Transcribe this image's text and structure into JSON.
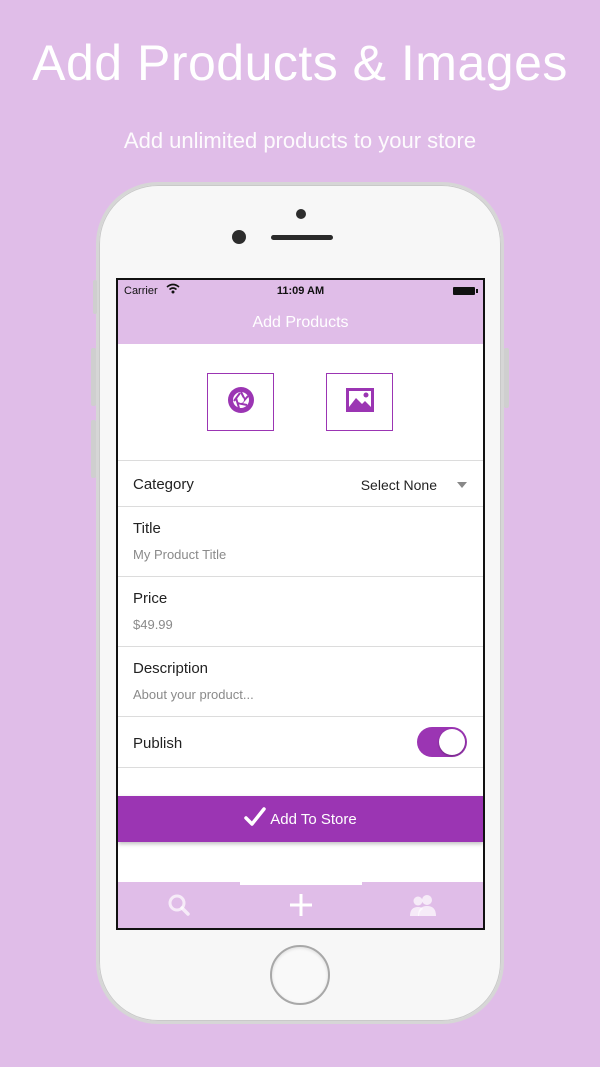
{
  "banner": {
    "headline": "Add Products & Images",
    "subline": "Add unlimited products to your store"
  },
  "status_bar": {
    "carrier": "Carrier",
    "wifi_icon": "wifi-icon",
    "time": "11:09 AM",
    "battery_icon": "battery-icon"
  },
  "nav": {
    "title": "Add Products"
  },
  "media": {
    "camera_icon": "camera-aperture-icon",
    "gallery_icon": "image-gallery-icon"
  },
  "form": {
    "category": {
      "label": "Category",
      "value": "Select None"
    },
    "title": {
      "label": "Title",
      "placeholder": "My Product Title"
    },
    "price": {
      "label": "Price",
      "placeholder": "$49.99"
    },
    "description": {
      "label": "Description",
      "placeholder": "About your product..."
    },
    "publish": {
      "label": "Publish",
      "enabled": true
    }
  },
  "actions": {
    "add_label": "Add To Store"
  },
  "tabs": [
    {
      "name": "search",
      "icon": "search-icon",
      "active": false
    },
    {
      "name": "add",
      "icon": "plus-icon",
      "active": true
    },
    {
      "name": "users",
      "icon": "users-icon",
      "active": false
    }
  ],
  "colors": {
    "background": "#e0bde8",
    "accent": "#9b35b3",
    "white": "#ffffff"
  }
}
